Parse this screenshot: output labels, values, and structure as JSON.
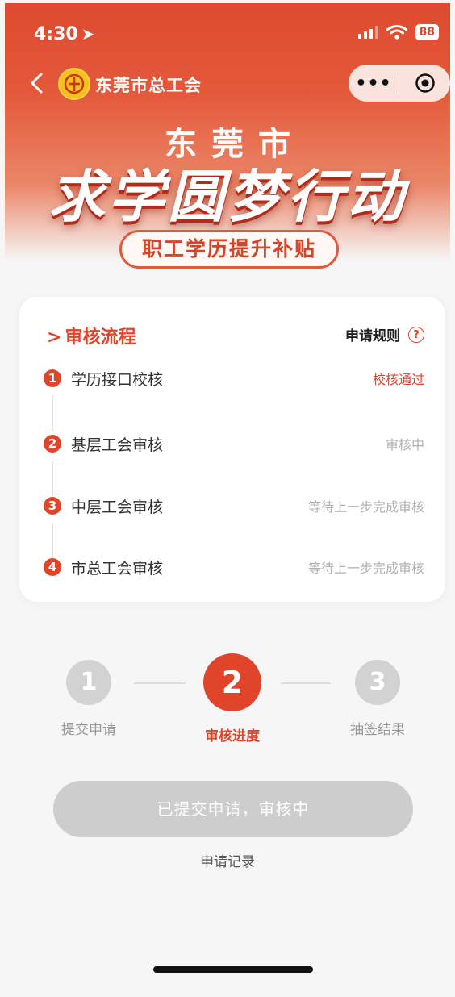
{
  "status_bar": {
    "time": "4:30",
    "battery": "88"
  },
  "nav": {
    "title": "东莞市总工会",
    "more": "•••"
  },
  "banner": {
    "subtitle": "东莞市",
    "title": "求学圆梦行动",
    "tag": "职工学历提升补贴"
  },
  "review": {
    "title": "审核流程",
    "rules_label": "申请规则",
    "steps": [
      {
        "num": "1",
        "label": "学历接口校核",
        "status": "校核通过"
      },
      {
        "num": "2",
        "label": "基层工会审核",
        "status": "审核中"
      },
      {
        "num": "3",
        "label": "中层工会审核",
        "status": "等待上一步完成审核"
      },
      {
        "num": "4",
        "label": "市总工会审核",
        "status": "等待上一步完成审核"
      }
    ]
  },
  "progress": {
    "steps": [
      {
        "num": "1",
        "label": "提交申请"
      },
      {
        "num": "2",
        "label": "审核进度"
      },
      {
        "num": "3",
        "label": "抽签结果"
      }
    ]
  },
  "action": {
    "button": "已提交申请，审核中",
    "record_link": "申请记录"
  },
  "colors": {
    "primary": "#e0442a",
    "disabled": "#cdcdcd"
  }
}
